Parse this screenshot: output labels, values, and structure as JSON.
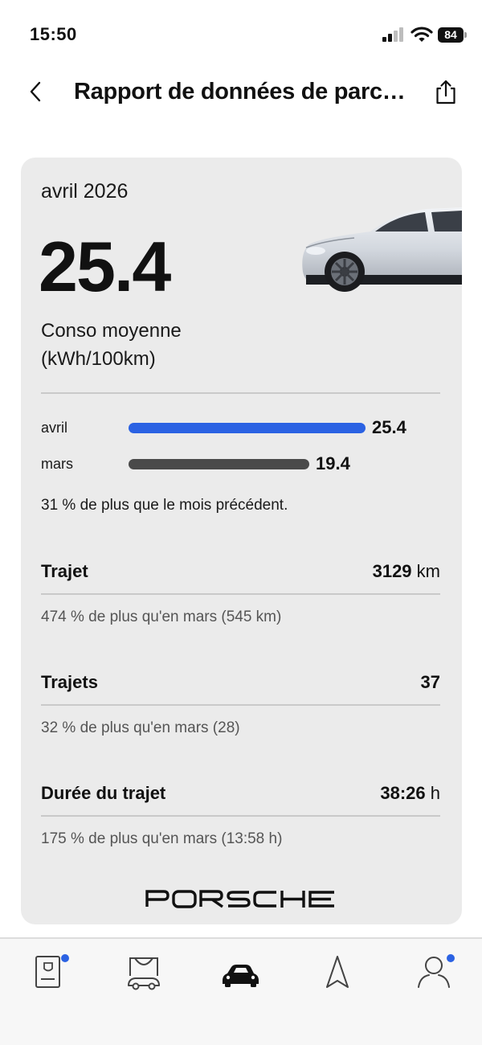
{
  "status_bar": {
    "time": "15:50",
    "battery": "84"
  },
  "nav": {
    "title": "Rapport de données de parco..."
  },
  "summary": {
    "period": "avril 2026",
    "value": "25.4",
    "label_line1": "Conso moyenne",
    "label_line2": "(kWh/100km)"
  },
  "comparison": {
    "current": {
      "label": "avril",
      "value": 25.4,
      "display": "25.4",
      "color": "#2b62e3"
    },
    "previous": {
      "label": "mars",
      "value": 19.4,
      "display": "19.4",
      "color": "#4a4a4a"
    },
    "note": "31 % de plus que le mois précédent."
  },
  "stats": [
    {
      "name": "Trajet",
      "value": "3129",
      "unit": "km",
      "note": "474 % de plus qu'en mars (545 km)"
    },
    {
      "name": "Trajets",
      "value": "37",
      "unit": "",
      "note": "32 % de plus qu'en mars (28)"
    },
    {
      "name": "Durée du trajet",
      "value": "38:26",
      "unit": "h",
      "note": "175 % de plus qu'en mars (13:58 h)"
    }
  ],
  "brand": {
    "logo_text": "PORSCHE"
  },
  "tab_bar": {
    "notification_color": "#2b62e3",
    "tabs": [
      {
        "icon": "document-card-icon",
        "badge": true,
        "active": false
      },
      {
        "icon": "garage-car-icon",
        "badge": false,
        "active": false
      },
      {
        "icon": "car-icon",
        "badge": false,
        "active": true
      },
      {
        "icon": "navigation-arrow-icon",
        "badge": false,
        "active": false
      },
      {
        "icon": "profile-icon",
        "badge": true,
        "active": false
      }
    ]
  }
}
